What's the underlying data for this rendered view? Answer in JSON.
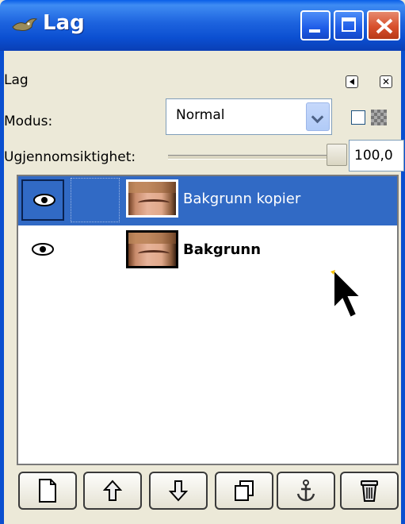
{
  "window": {
    "title": "Lag"
  },
  "panel": {
    "title": "Lag",
    "mode_label": "Modus:",
    "mode_value": "Normal",
    "opacity_label": "Ugjennomsiktighet:",
    "opacity_value": "100,0",
    "opacity_level": 1.0
  },
  "layers": [
    {
      "name": "Bakgrunn kopier",
      "visible": true,
      "selected": true
    },
    {
      "name": "Bakgrunn",
      "visible": true,
      "selected": false
    }
  ],
  "toolbar": {
    "icons": [
      "new-layer-icon",
      "raise-layer-icon",
      "lower-layer-icon",
      "duplicate-layer-icon",
      "anchor-layer-icon",
      "delete-layer-icon"
    ]
  },
  "colors": {
    "titlebar": "#0a4fd0",
    "selection": "#316ac5",
    "close": "#d8502c"
  }
}
